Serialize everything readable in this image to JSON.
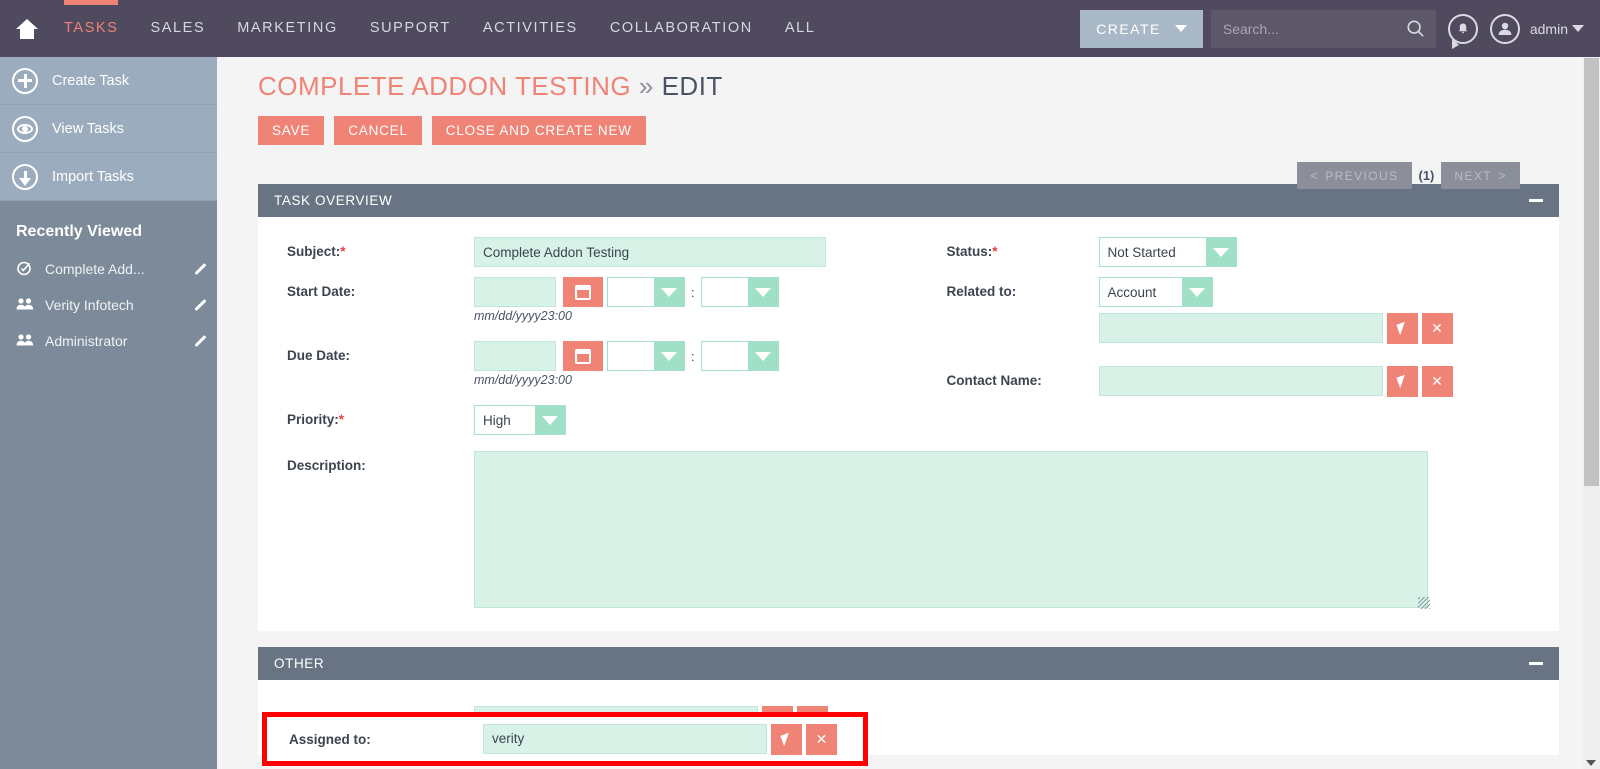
{
  "topnav": {
    "home_icon": "home-icon",
    "items": [
      {
        "label": "TASKS",
        "active": true
      },
      {
        "label": "SALES",
        "active": false
      },
      {
        "label": "MARKETING",
        "active": false
      },
      {
        "label": "SUPPORT",
        "active": false
      },
      {
        "label": "ACTIVITIES",
        "active": false
      },
      {
        "label": "COLLABORATION",
        "active": false
      },
      {
        "label": "ALL",
        "active": false
      }
    ],
    "create_label": "CREATE",
    "search_placeholder": "Search...",
    "search_value": "",
    "search_icon": "search-icon",
    "bell_icon": "bell-notification-icon",
    "user_icon": "user-avatar-icon",
    "user_label": "admin",
    "accent_color": "#ef8375",
    "bar_color": "#4f4a5e"
  },
  "sidebar": {
    "actions": [
      {
        "label": "Create Task",
        "icon": "plus-circle-icon"
      },
      {
        "label": "View Tasks",
        "icon": "eye-circle-icon"
      },
      {
        "label": "Import Tasks",
        "icon": "download-circle-icon"
      }
    ],
    "recent_header": "Recently Viewed",
    "recent_items": [
      {
        "label": "Complete Add...",
        "icon": "task-check-icon",
        "edit_icon": "pencil-icon"
      },
      {
        "label": "Verity Infotech",
        "icon": "contacts-icon",
        "edit_icon": "pencil-icon"
      },
      {
        "label": "Administrator",
        "icon": "contacts-icon",
        "edit_icon": "pencil-icon"
      }
    ],
    "collapse_icon": "collapse-sidebar-icon"
  },
  "page": {
    "title_record": "COMPLETE ADDON TESTING",
    "title_separator": "»",
    "title_mode": "EDIT",
    "buttons": {
      "save": "SAVE",
      "cancel": "CANCEL",
      "close_and_create_new": "CLOSE AND CREATE NEW"
    },
    "pager": {
      "previous": "PREVIOUS",
      "count": "(1)",
      "next": "NEXT"
    }
  },
  "task_overview": {
    "header": "TASK OVERVIEW",
    "collapse_icon": "minus-icon",
    "subject": {
      "label": "Subject:",
      "required": true,
      "value": "Complete Addon Testing"
    },
    "start_date": {
      "label": "Start Date:",
      "required": false,
      "value": "",
      "hour": "",
      "minute": "",
      "separator": ":",
      "hint": "mm/dd/yyyy23:00",
      "calendar_icon": "calendar-icon"
    },
    "due_date": {
      "label": "Due Date:",
      "required": false,
      "value": "",
      "hour": "",
      "minute": "",
      "separator": ":",
      "hint": "mm/dd/yyyy23:00",
      "calendar_icon": "calendar-icon"
    },
    "priority": {
      "label": "Priority:",
      "required": true,
      "value": "High"
    },
    "description": {
      "label": "Description:",
      "required": false,
      "value": ""
    },
    "status": {
      "label": "Status:",
      "required": true,
      "value": "Not Started"
    },
    "related_to": {
      "label": "Related to:",
      "required": false,
      "type_value": "Account",
      "value": "",
      "select_icon": "cursor-select-icon",
      "clear_icon": "clear-x-icon"
    },
    "contact_name": {
      "label": "Contact Name:",
      "required": false,
      "value": "",
      "select_icon": "cursor-select-icon",
      "clear_icon": "clear-x-icon"
    }
  },
  "other": {
    "header": "OTHER",
    "collapse_icon": "minus-icon",
    "assigned_to": {
      "label": "Assigned to:",
      "required": false,
      "value": "verity",
      "select_icon": "cursor-select-icon",
      "clear_icon": "clear-x-icon"
    },
    "highlight_color": "#fe0000"
  },
  "colors": {
    "accent": "#ef8375",
    "panel_header": "#687484",
    "field_bg": "#d8f2e7",
    "dropdown_arrow": "#9fe0c6",
    "topbar": "#4f4a5e",
    "sidebar": "#7c8a99"
  }
}
